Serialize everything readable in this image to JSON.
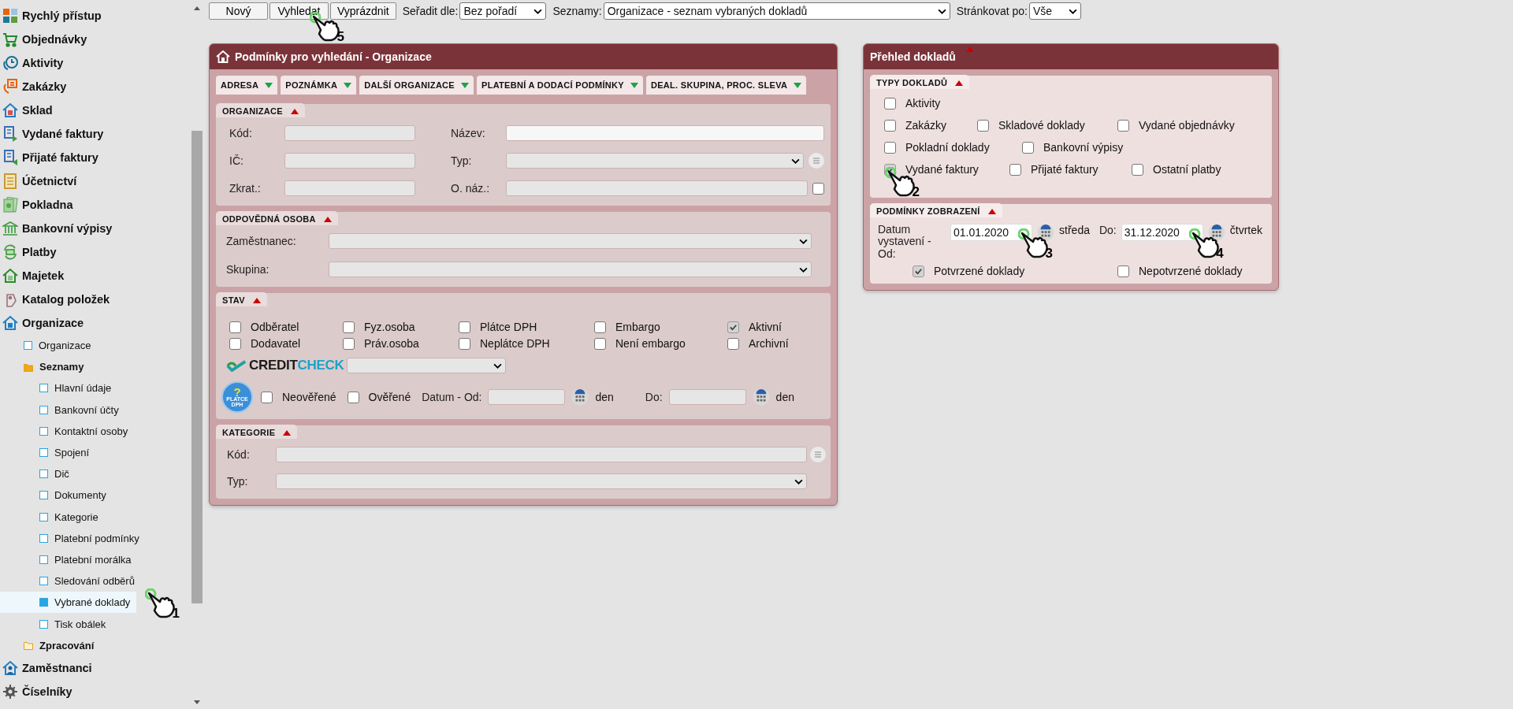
{
  "toolbar": {
    "buttons": [
      {
        "label": "Nový"
      },
      {
        "label": "Vyhledat",
        "callout": "5"
      },
      {
        "label": "Vyprázdnit"
      }
    ],
    "dropdowns": [
      {
        "label": "Seřadit dle:",
        "value": "Bez pořadí"
      },
      {
        "label": "Seznamy:",
        "value": "Organizace - seznam vybraných dokladů"
      },
      {
        "label": "Stránkovat po:",
        "value": "Vše"
      }
    ]
  },
  "sidebar": {
    "items": [
      {
        "label": "Rychlý přístup",
        "selected": false
      },
      {
        "label": "Objednávky",
        "selected": false
      },
      {
        "label": "Aktivity",
        "selected": false
      },
      {
        "label": "Zakázky",
        "selected": false
      },
      {
        "label": "Sklad",
        "selected": false
      },
      {
        "label": "Vydané faktury",
        "selected": false
      },
      {
        "label": "Přijaté faktury",
        "selected": false
      },
      {
        "label": "Účetnictví",
        "selected": false
      },
      {
        "label": "Pokladna",
        "selected": false
      },
      {
        "label": "Bankovní výpisy",
        "selected": false
      },
      {
        "label": "Platby",
        "selected": false
      },
      {
        "label": "Majetek",
        "selected": false
      },
      {
        "label": "Katalog položek",
        "selected": false
      },
      {
        "label": "Organizace",
        "selected": false,
        "children": [
          {
            "kind": "page",
            "label": "Organizace",
            "selected": false
          },
          {
            "kind": "folder",
            "label": "Seznamy",
            "expanded": true,
            "children": [
              {
                "label": "Hlavní údaje",
                "selected": false
              },
              {
                "label": "Bankovní účty",
                "selected": false
              },
              {
                "label": "Kontaktní osoby",
                "selected": false
              },
              {
                "label": "Spojení",
                "selected": false
              },
              {
                "label": "Dič",
                "selected": false
              },
              {
                "label": "Dokumenty",
                "selected": false
              },
              {
                "label": "Kategorie",
                "selected": false
              },
              {
                "label": "Platební podmínky",
                "selected": false
              },
              {
                "label": "Platební morálka",
                "selected": false
              },
              {
                "label": "Sledování odběrů",
                "selected": false
              },
              {
                "label": "Vybrané doklady",
                "selected": true,
                "callout": "1"
              },
              {
                "label": "Tisk obálek",
                "selected": false
              }
            ]
          },
          {
            "kind": "folder",
            "label": "Zpracování",
            "expanded": false
          }
        ]
      },
      {
        "label": "Zaměstnanci",
        "selected": false
      },
      {
        "label": "Číselníky",
        "selected": false
      }
    ]
  },
  "search_panel": {
    "title": "Podmínky pro vyhledání - Organizace",
    "tabs": [
      {
        "label": "ADRESA",
        "expanded": false
      },
      {
        "label": "POZNÁMKA",
        "expanded": false
      },
      {
        "label": "DALŠÍ ORGANIZACE",
        "expanded": false
      },
      {
        "label": "PLATEBNÍ A DODACÍ PODMÍNKY",
        "expanded": false
      },
      {
        "label": "DEAL. SKUPINA, PROC. SLEVA",
        "expanded": false
      }
    ],
    "organization": {
      "title": "ORGANIZACE",
      "expanded": true,
      "fields": [
        {
          "label": "Kód:",
          "kind": "text"
        },
        {
          "label": "Název:",
          "kind": "text"
        },
        {
          "label": "IČ:",
          "kind": "text"
        },
        {
          "label": "Typ:",
          "kind": "select-list"
        },
        {
          "label": "Zkrat.:",
          "kind": "text"
        },
        {
          "label": "O. náz.:",
          "kind": "text-check",
          "checked": false
        }
      ]
    },
    "person": {
      "title": "ODPOVĚDNÁ OSOBA",
      "expanded": true,
      "fields": [
        {
          "label": "Zaměstnanec:",
          "kind": "select"
        },
        {
          "label": "Skupina:",
          "kind": "select"
        }
      ]
    },
    "state": {
      "title": "STAV",
      "expanded": true,
      "checkboxes": [
        {
          "label": "Odběratel",
          "checked": false
        },
        {
          "label": "Fyz.osoba",
          "checked": false
        },
        {
          "label": "Plátce DPH",
          "checked": false
        },
        {
          "label": "Embargo",
          "checked": false
        },
        {
          "label": "Aktivní",
          "checked": true
        },
        {
          "label": "Dodavatel",
          "checked": false
        },
        {
          "label": "Práv.osoba",
          "checked": false
        },
        {
          "label": "Neplátce DPH",
          "checked": false
        },
        {
          "label": "Není embargo",
          "checked": false
        },
        {
          "label": "Archivní",
          "checked": false
        }
      ],
      "creditcheck": {
        "brand_left": "CREDIT",
        "brand_right": "CHECK"
      },
      "vat_badge": {
        "mark": "?",
        "text": "PLATCE DPH"
      },
      "vat_checks": [
        {
          "label": "Neověřené",
          "checked": false
        },
        {
          "label": "Ověřené",
          "checked": false
        }
      ],
      "date_from": {
        "label": "Datum - Od:",
        "unit": "den"
      },
      "date_to": {
        "label": "Do:",
        "unit": "den"
      }
    },
    "category": {
      "title": "KATEGORIE",
      "expanded": true,
      "fields": [
        {
          "label": "Kód:",
          "kind": "text-list"
        },
        {
          "label": "Typ:",
          "kind": "select"
        }
      ]
    }
  },
  "overview": {
    "title": "Přehled dokladů",
    "expanded": true,
    "types": {
      "title": "TYPY DOKLADŮ",
      "expanded": true,
      "rows": [
        [
          {
            "label": "Aktivity",
            "checked": false
          }
        ],
        [
          {
            "label": "Zakázky",
            "checked": false
          },
          {
            "label": "Skladové doklady",
            "checked": false
          },
          {
            "label": "Vydané objednávky",
            "checked": false
          }
        ],
        [
          {
            "label": "Pokladní doklady",
            "checked": false
          },
          {
            "label": "Bankovní výpisy",
            "checked": false
          }
        ],
        [
          {
            "label": "Vydané faktury",
            "checked": true,
            "callout": "2"
          },
          {
            "label": "Přijaté faktury",
            "checked": false
          },
          {
            "label": "Ostatní platby",
            "checked": false
          }
        ]
      ]
    },
    "display": {
      "title": "PODMÍNKY ZOBRAZENÍ",
      "expanded": true,
      "date_label": "Datum vystavení - Od:",
      "date_from": {
        "value": "01.01.2020",
        "day": "středa",
        "callout": "3"
      },
      "to_label": "Do:",
      "date_to": {
        "value": "31.12.2020",
        "day": "čtvrtek",
        "callout": "4"
      },
      "checks": [
        {
          "label": "Potvrzené doklady",
          "checked": true
        },
        {
          "label": "Nepotvrzené doklady",
          "checked": false
        }
      ]
    }
  }
}
